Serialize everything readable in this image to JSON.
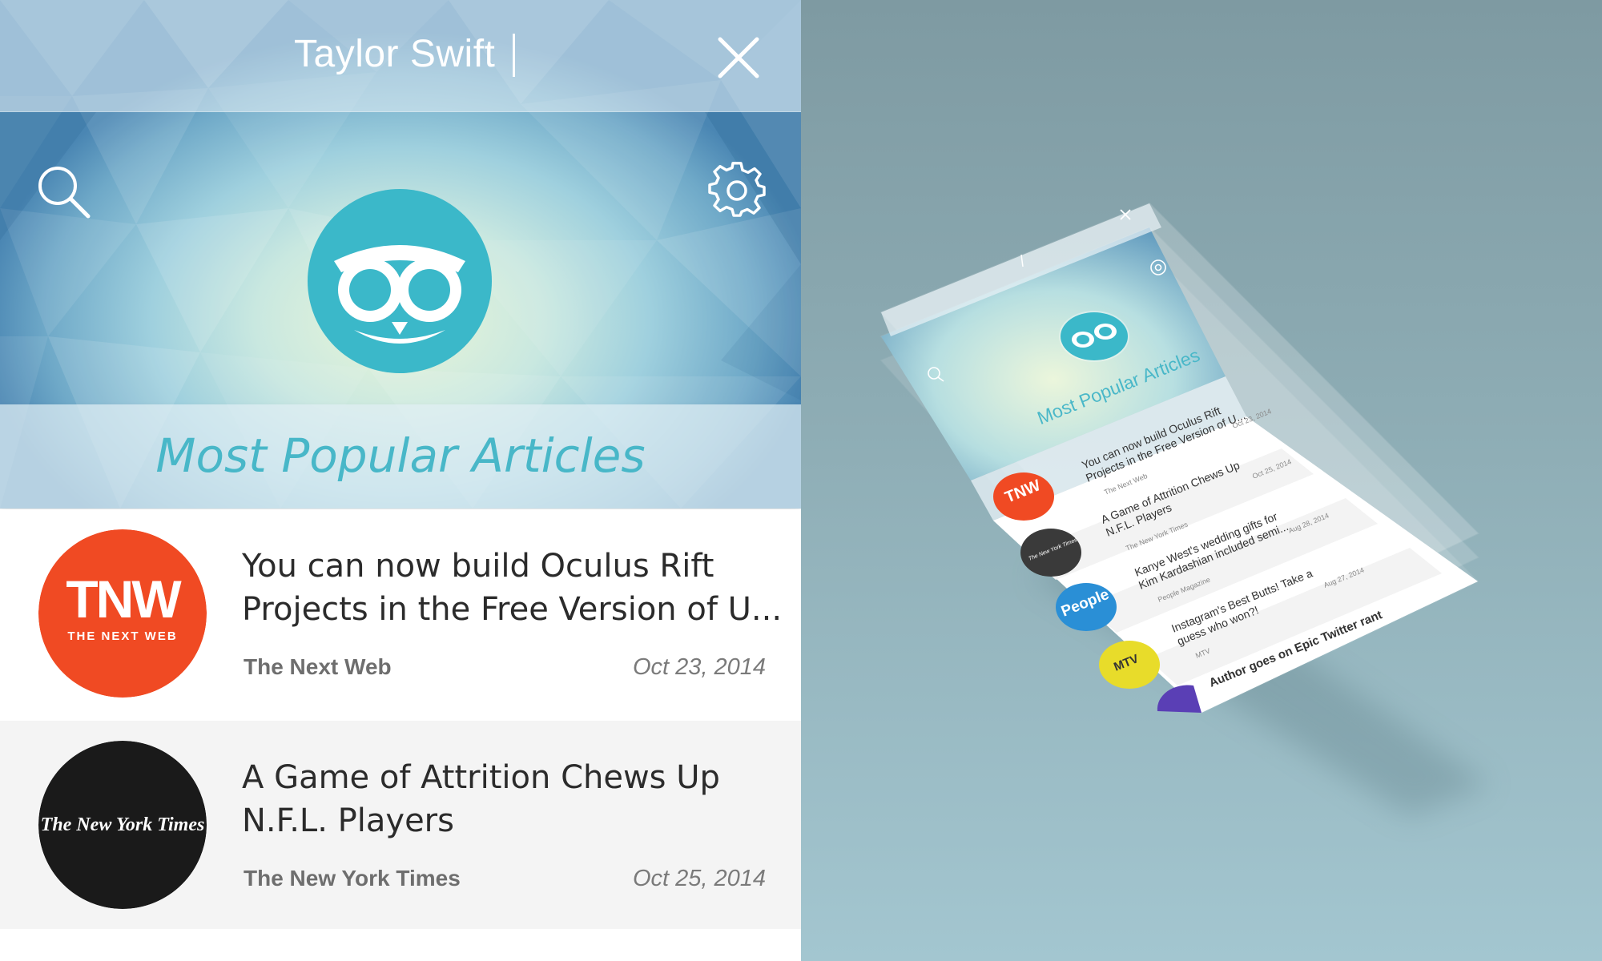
{
  "search": {
    "query": "Taylor Swift"
  },
  "section": {
    "title": "Most Popular Articles"
  },
  "articles": [
    {
      "title": "You can now build Oculus Rift Projects in the Free Version of U...",
      "source": "The Next Web",
      "date": "Oct 23, 2014",
      "logo_text": "TNW",
      "logo_sub": "THE NEXT WEB",
      "logo_color": "#f04a23"
    },
    {
      "title": "A Game of Attrition Chews Up N.F.L. Players",
      "source": "The New York Times",
      "date": "Oct 25, 2014",
      "logo_text": "The New York Times",
      "logo_color": "#1a1a1a"
    }
  ],
  "mockup": {
    "section_title": "Most Popular Articles",
    "items": [
      {
        "title_1": "You can now build Oculus Rift",
        "title_2": "Projects in the Free Version of U...",
        "source": "The Next Web",
        "date": "Oct 23, 2014",
        "logo_text": "TNW",
        "logo_color": "#f04a23"
      },
      {
        "title_1": "A Game of Attrition Chews Up",
        "title_2": "N.F.L. Players",
        "source": "The New York Times",
        "date": "Oct 25, 2014",
        "logo_text": "The New York Times",
        "logo_color": "#3a3a3a"
      },
      {
        "title_1": "Kanye West's wedding gifts for",
        "title_2": "Kim Kardashian included semi...",
        "source": "People Magazine",
        "date": "Aug 28, 2014",
        "logo_text": "People",
        "logo_color": "#2a8fd6"
      },
      {
        "title_1": "Instagram's Best Butts! Take a",
        "title_2": "guess who won?!",
        "source": "MTV",
        "date": "Aug 27, 2014",
        "logo_text": "MTV",
        "logo_color": "#e8dc2a"
      },
      {
        "title_1": "Author goes on Epic Twitter rant",
        "title_2": "",
        "source": "",
        "date": "",
        "logo_text": "",
        "logo_color": "#5a3fb5"
      }
    ]
  },
  "colors": {
    "accent": "#48b7c8",
    "tnw": "#f04a23",
    "nyt": "#1a1a1a"
  },
  "icons": [
    "close-icon",
    "search-icon",
    "gear-icon",
    "owl-logo-icon"
  ]
}
